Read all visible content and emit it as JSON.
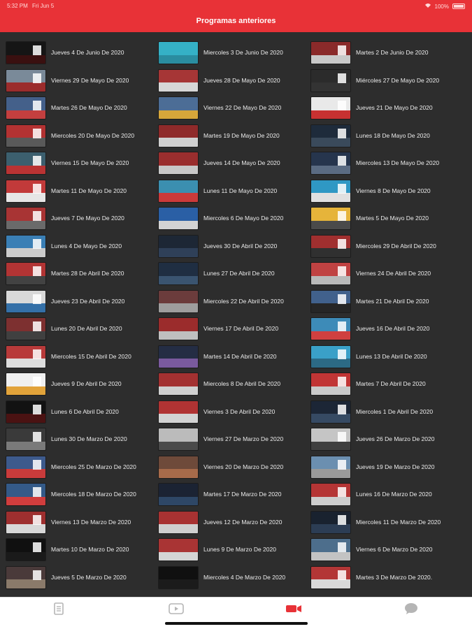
{
  "status": {
    "time": "5:32 PM",
    "date": "Fri Jun 5",
    "battery": "100%"
  },
  "header": {
    "title": "Programas anteriores"
  },
  "colors": {
    "accent": "#e83237",
    "background": "#2d2d2d",
    "tab_inactive": "#b5b5b5"
  },
  "programs": [
    {
      "label": "Jueves 4 De Junio De 2020",
      "thumb": [
        "#151515",
        "#3a1010"
      ]
    },
    {
      "label": "Miercoles 3 De Junio De 2020",
      "thumb": [
        "#35b1c6",
        "#2a8da0"
      ]
    },
    {
      "label": "Martes 2 De Junio De 2020",
      "thumb": [
        "#8a2a2a",
        "#c9c9c9"
      ]
    },
    {
      "label": "Viernes 29 De Mayo De 2020",
      "thumb": [
        "#7a8a99",
        "#9b2c2c"
      ]
    },
    {
      "label": "Jueves 28 De Mayo De 2020",
      "thumb": [
        "#a63636",
        "#d7d7d7"
      ]
    },
    {
      "label": "Miércoles 27 De Mayo De 2020",
      "thumb": [
        "#2b2b2b",
        "#333333"
      ]
    },
    {
      "label": "Martes 26 De Mayo De 2020",
      "thumb": [
        "#44608a",
        "#c33f3f"
      ]
    },
    {
      "label": "Viernes 22 De Mayo De 2020",
      "thumb": [
        "#4c6d96",
        "#d6a63a"
      ]
    },
    {
      "label": "Jueves 21 De Mayo De 2020",
      "thumb": [
        "#e9e9e9",
        "#c73131"
      ]
    },
    {
      "label": "Miercoles 20 De Mayo De 2020",
      "thumb": [
        "#b33232",
        "#595959"
      ]
    },
    {
      "label": "Martes 19 De Mayo De 2020",
      "thumb": [
        "#8f2a2a",
        "#cfcfcf"
      ]
    },
    {
      "label": "Lunes 18 De Mayo De 2020",
      "thumb": [
        "#1e2b3b",
        "#3a4a5b"
      ]
    },
    {
      "label": "Viernes 15 De Mayo De 2020",
      "thumb": [
        "#3c5f6e",
        "#b93333"
      ]
    },
    {
      "label": "Jueves 14 De Mayo De 2020",
      "thumb": [
        "#9a2e2e",
        "#c8c8c8"
      ]
    },
    {
      "label": "Miercoles 13 De Mayo De 2020",
      "thumb": [
        "#26354d",
        "#5a6b82"
      ]
    },
    {
      "label": "Martes 11 De Mayo De 2020",
      "thumb": [
        "#c23a3a",
        "#e6e6e6"
      ]
    },
    {
      "label": "Lunes 11 De Mayo De 2020",
      "thumb": [
        "#3b8fb0",
        "#cb3a3a"
      ]
    },
    {
      "label": "Viernes 8 De Mayo De 2020",
      "thumb": [
        "#2f98c4",
        "#e0e0e0"
      ]
    },
    {
      "label": "Jueves 7 De Mayo De 2020",
      "thumb": [
        "#a83434",
        "#6a6a6a"
      ]
    },
    {
      "label": "Miercoles 6 De Mayo De 2020",
      "thumb": [
        "#2a5fa5",
        "#d3d3d3"
      ]
    },
    {
      "label": "Martes 5 De Mayo De 2020",
      "thumb": [
        "#e6b43a",
        "#4a4a4a"
      ]
    },
    {
      "label": "Lunes 4 De Mayo De 2020",
      "thumb": [
        "#3a7fb5",
        "#cccccc"
      ]
    },
    {
      "label": "Jueves 30 De Abril De 2020",
      "thumb": [
        "#1d2735",
        "#2f4058"
      ]
    },
    {
      "label": "Miercoles 29 De Abril De 2020",
      "thumb": [
        "#a02f2f",
        "#303030"
      ]
    },
    {
      "label": "Martes 28 De Abril De 2020",
      "thumb": [
        "#b23434",
        "#424242"
      ]
    },
    {
      "label": "Lunes 27 De Abril De 2020",
      "thumb": [
        "#1f2e42",
        "#3a5470"
      ]
    },
    {
      "label": "Viernes 24 De Abril De 2020",
      "thumb": [
        "#c04242",
        "#b9b9b9"
      ]
    },
    {
      "label": "Jueves 23 De Abril De 2020",
      "thumb": [
        "#d9d9d9",
        "#3470a8"
      ]
    },
    {
      "label": "Miercoles 22 De Abril De 2020",
      "thumb": [
        "#6b3c3c",
        "#9e9e9e"
      ]
    },
    {
      "label": "Martes 21 De Abril De 2020",
      "thumb": [
        "#41618c",
        "#262626"
      ]
    },
    {
      "label": "Lunes 20 De Abril De 2020",
      "thumb": [
        "#7d3030",
        "#404040"
      ]
    },
    {
      "label": "Viernes 17 De Abril De 2020",
      "thumb": [
        "#9b2c2c",
        "#bfbfbf"
      ]
    },
    {
      "label": "Jueves 16 De Abril De 2020",
      "thumb": [
        "#3d8bb8",
        "#cf4040"
      ]
    },
    {
      "label": "Miercoles 15 De Abril De 2020",
      "thumb": [
        "#b83a3a",
        "#dddddd"
      ]
    },
    {
      "label": "Martes 14 De Abril De 2020",
      "thumb": [
        "#242d44",
        "#7a5a9e"
      ]
    },
    {
      "label": "Lunes 13 De Abril De 2020",
      "thumb": [
        "#3aa0c8",
        "#2c6a85"
      ]
    },
    {
      "label": "Jueves 9 De Abril De 2020",
      "thumb": [
        "#f0f0f0",
        "#e2a33a"
      ]
    },
    {
      "label": "Miercoles 8 De Abril De 2020",
      "thumb": [
        "#a33131",
        "#d0d0d0"
      ]
    },
    {
      "label": "Martes 7 De Abril De 2020",
      "thumb": [
        "#c13535",
        "#cacaca"
      ]
    },
    {
      "label": "Lunes 6 De Abril De 2020",
      "thumb": [
        "#121212",
        "#4a1212"
      ]
    },
    {
      "label": "Viernes 3 De Abril De 2020",
      "thumb": [
        "#b03333",
        "#d2d2d2"
      ]
    },
    {
      "label": "Miercoles 1 De Abril De 2020",
      "thumb": [
        "#1c2636",
        "#364a63"
      ]
    },
    {
      "label": "Lunes 30 De Marzo De 2020",
      "thumb": [
        "#3a3a3a",
        "#7a7a7a"
      ]
    },
    {
      "label": "Viernes 27 De Marzo De 2020",
      "thumb": [
        "#bbbbbb",
        "#4a4a4a"
      ]
    },
    {
      "label": "Jueves 26 De Marzo De 2020",
      "thumb": [
        "#c5c5c5",
        "#3f3f3f"
      ]
    },
    {
      "label": "Miercoles 25 De Marzo De 2020",
      "thumb": [
        "#3d5a8c",
        "#c93b3b"
      ]
    },
    {
      "label": "Viernes 20 De Marzo De 2020",
      "thumb": [
        "#6e4a3a",
        "#a76b4a"
      ]
    },
    {
      "label": "Jueves 19 De Marzo De 2020",
      "thumb": [
        "#6b8fb0",
        "#9a9a9a"
      ]
    },
    {
      "label": "Miercoles 18 De Marzo De 2020",
      "thumb": [
        "#345a88",
        "#d03d3d"
      ]
    },
    {
      "label": "Martes 17 De Marzo De 2020",
      "thumb": [
        "#1b2333",
        "#2e4766"
      ]
    },
    {
      "label": "Lunes 16 De Marzo De 2020",
      "thumb": [
        "#b53535",
        "#cdcdcd"
      ]
    },
    {
      "label": "Viernes 13 De Marzo De 2020",
      "thumb": [
        "#9e2f2f",
        "#d8d8d8"
      ]
    },
    {
      "label": "Jueves 12 De Marzo De 2020",
      "thumb": [
        "#a83232",
        "#cfcfcf"
      ]
    },
    {
      "label": "Miercoles 11 De Marzo De 2020",
      "thumb": [
        "#19222f",
        "#2c3d54"
      ]
    },
    {
      "label": "Martes 10 De Marzo De 2020",
      "thumb": [
        "#101010",
        "#1a1a1a"
      ]
    },
    {
      "label": "Lunes 9 De Marzo De 2020",
      "thumb": [
        "#a93434",
        "#d4d4d4"
      ]
    },
    {
      "label": "Viernes 6 De Marzo De 2020",
      "thumb": [
        "#4d6e8c",
        "#c3c3c3"
      ]
    },
    {
      "label": "Jueves 5 De Marzo De 2020",
      "thumb": [
        "#4a3a3a",
        "#8a7a6a"
      ]
    },
    {
      "label": "Miercoles 4 De Marzo De 2020",
      "thumb": [
        "#101010",
        "#1b1b1b"
      ]
    },
    {
      "label": "Martes 3 De Marzo De 2020.",
      "thumb": [
        "#b33636",
        "#d9d9d9"
      ]
    }
  ],
  "tabs": [
    {
      "name": "news",
      "icon": "document-icon",
      "active": false
    },
    {
      "name": "videos",
      "icon": "play-icon",
      "active": false
    },
    {
      "name": "programs",
      "icon": "camera-icon",
      "active": true
    },
    {
      "name": "chat",
      "icon": "chat-icon",
      "active": false
    }
  ]
}
